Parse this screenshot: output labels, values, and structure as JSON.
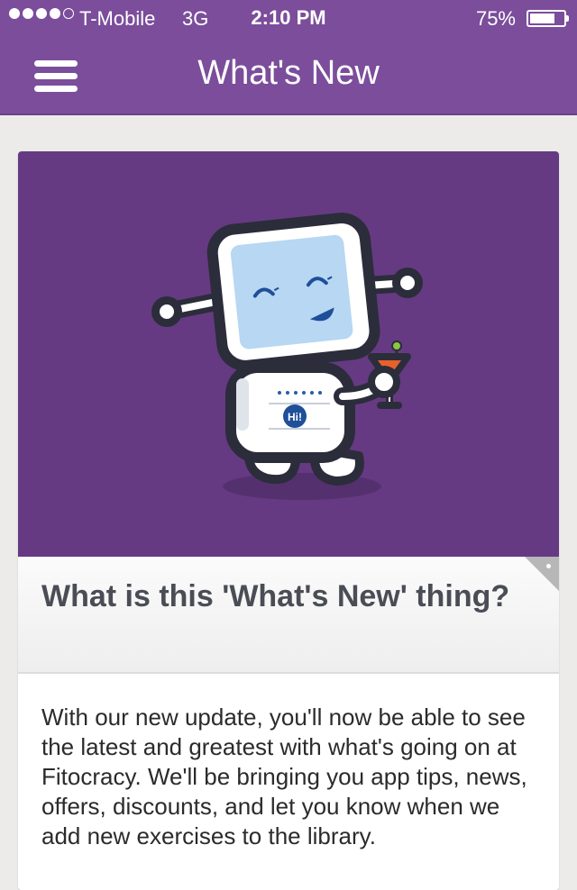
{
  "status_bar": {
    "carrier": "T-Mobile",
    "network": "3G",
    "time": "2:10 PM",
    "battery_percent": "75%",
    "battery_level": 0.75,
    "signal_bars_filled": 4,
    "signal_bars_total": 5
  },
  "nav": {
    "title": "What's New",
    "menu_icon": "hamburger-menu-icon"
  },
  "card": {
    "illustration": "robot-mascot-with-cocktail",
    "badge_text": "Hi!",
    "heading": "What is this 'What's New' thing?",
    "body": "With our new update, you'll now be able to see the latest and greatest with what's going on at Fitocracy. We'll be bringing you app tips, news, offers, discounts, and let you know when we add new exercises to the library."
  },
  "colors": {
    "brand_purple": "#7b4d9b",
    "hero_purple": "#653a82",
    "page_background": "#ecebe9",
    "heading_text": "#4a4d55"
  }
}
